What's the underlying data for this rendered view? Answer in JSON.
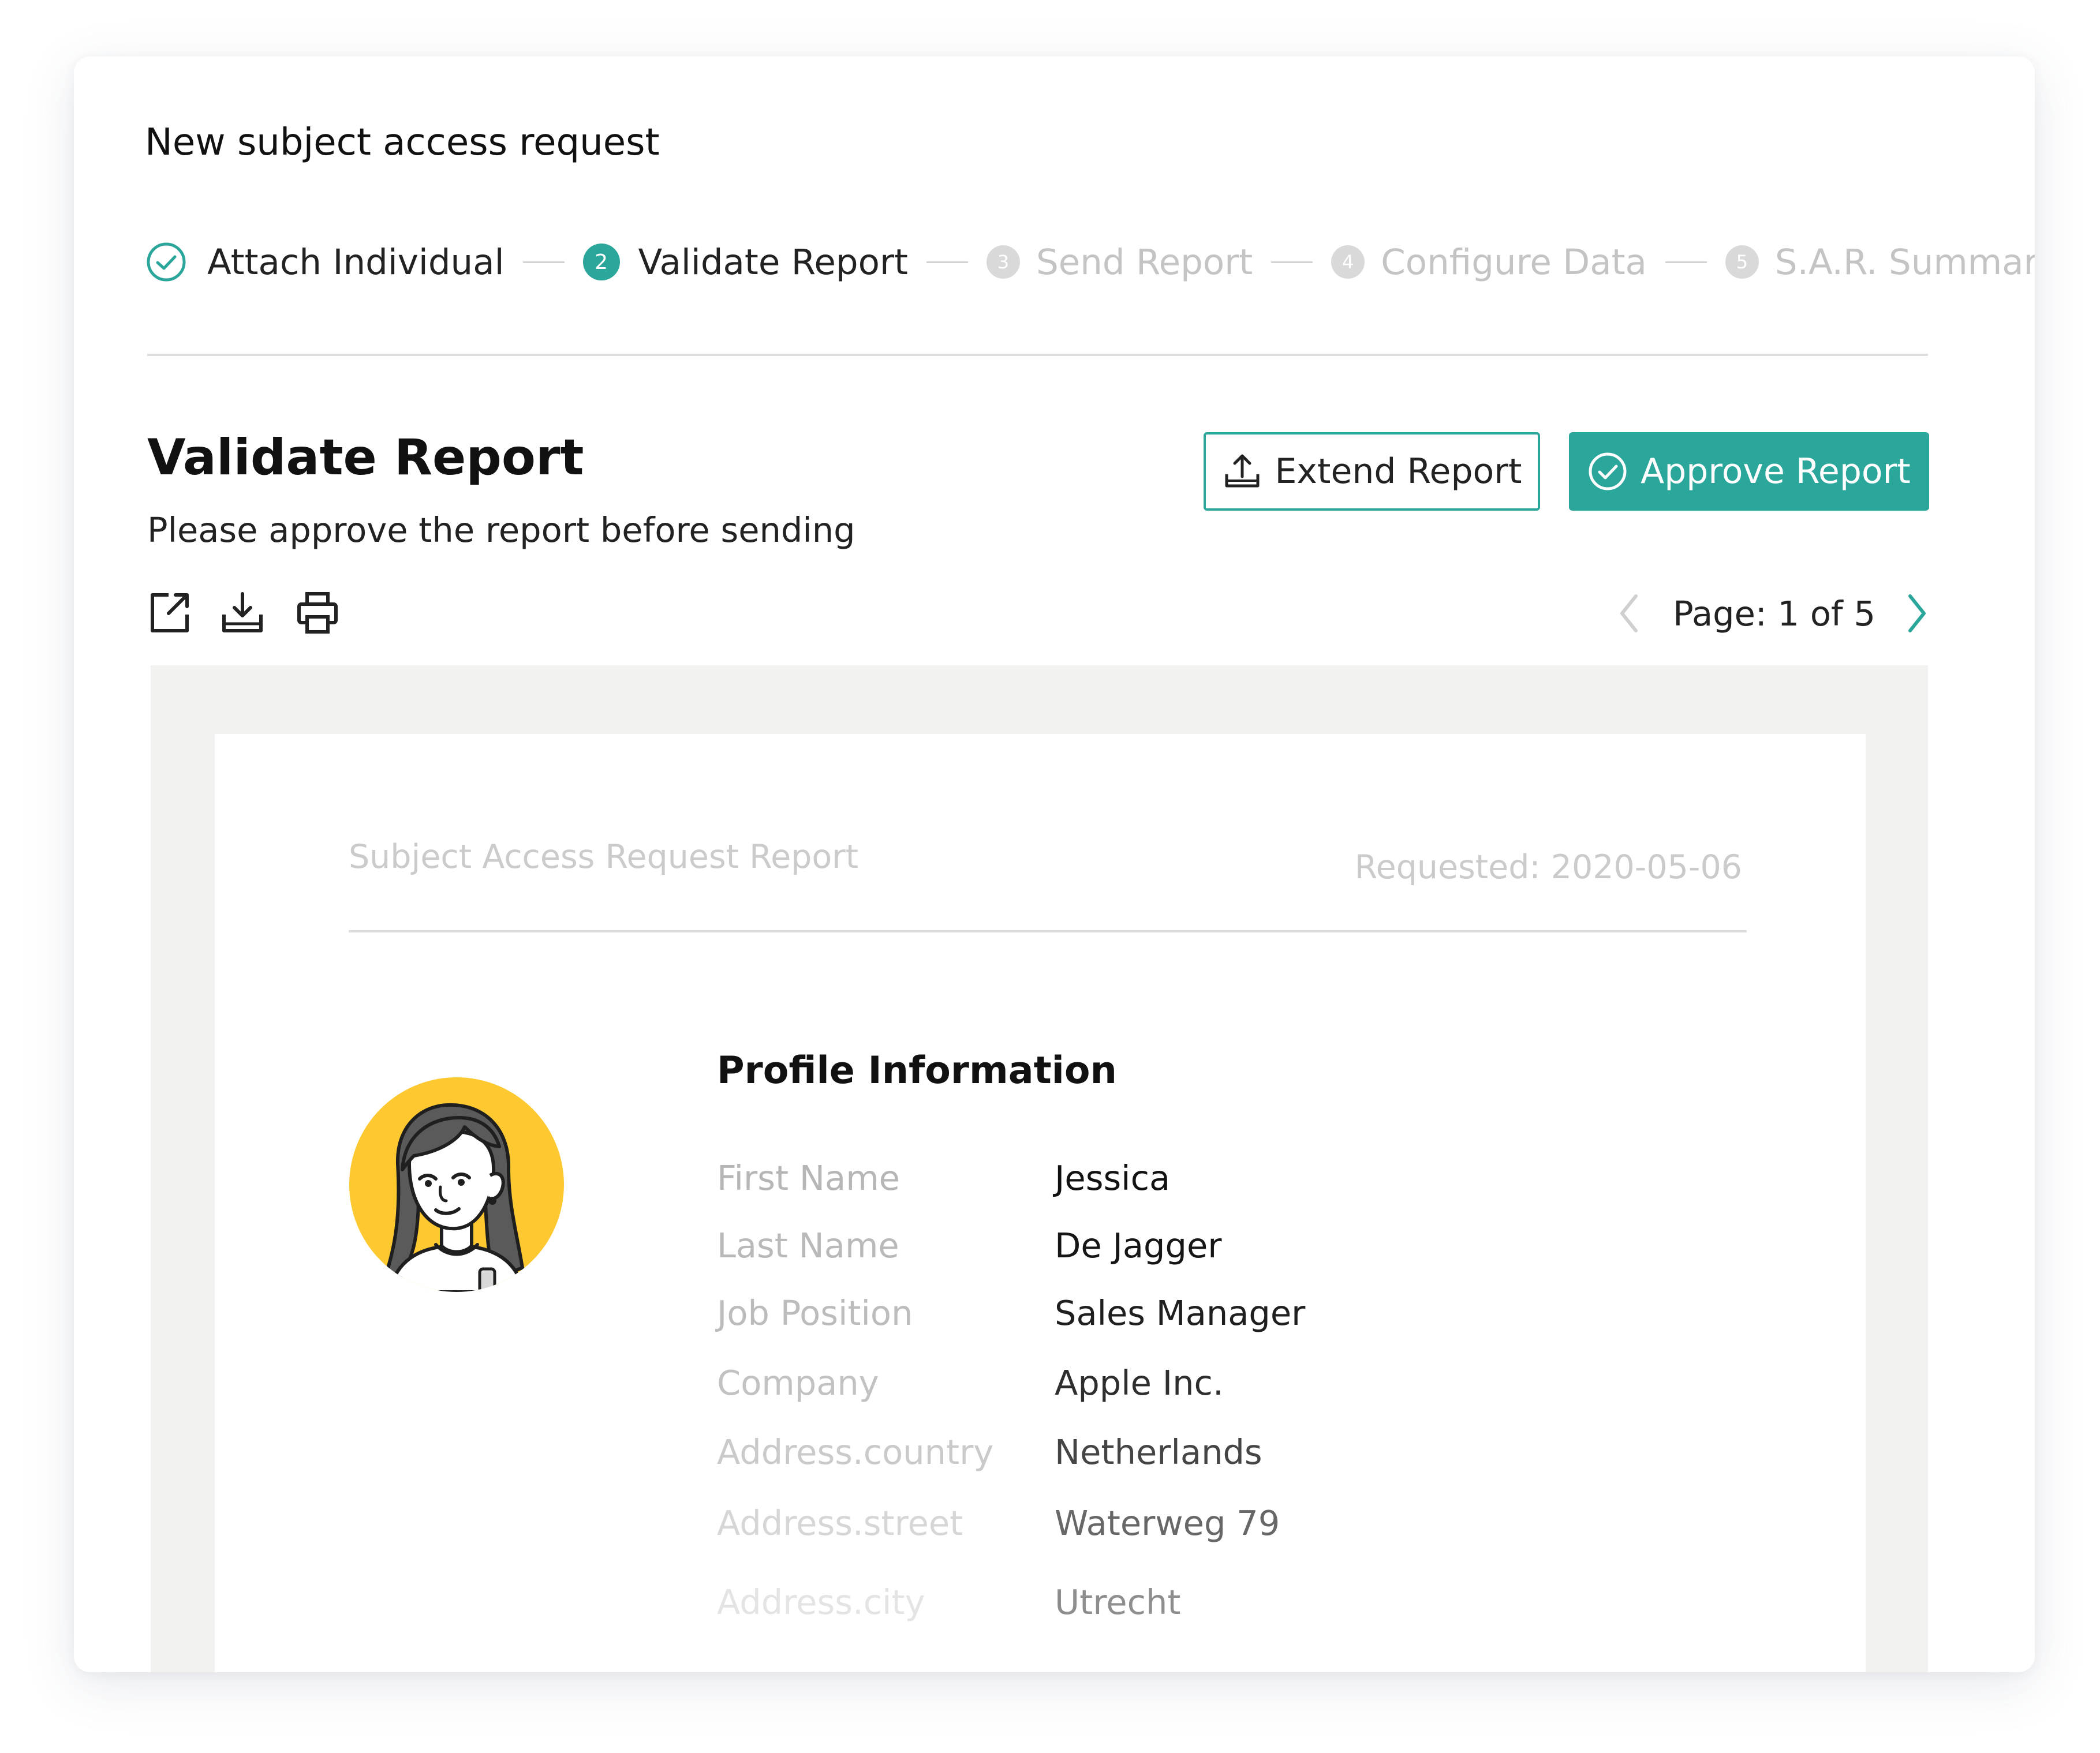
{
  "dialog": {
    "title": "New subject access request"
  },
  "stepper": {
    "steps": [
      {
        "number": "1",
        "label": "Attach Individual",
        "state": "done"
      },
      {
        "number": "2",
        "label": "Validate Report",
        "state": "active"
      },
      {
        "number": "3",
        "label": "Send Report",
        "state": "todo"
      },
      {
        "number": "4",
        "label": "Configure Data",
        "state": "todo"
      },
      {
        "number": "5",
        "label": "S.A.R. Summary",
        "state": "todo"
      }
    ]
  },
  "section": {
    "title": "Validate Report",
    "subtitle": "Please approve the report before sending"
  },
  "actions": {
    "extend_label": "Extend Report",
    "approve_label": "Approve Report"
  },
  "toolbar": {
    "icons": [
      "open-external-icon",
      "download-icon",
      "print-icon"
    ]
  },
  "pager": {
    "text": "Page: 1 of 5"
  },
  "report": {
    "title": "Subject Access Request Report",
    "requested": "Requested: 2020-05-06",
    "profile_title": "Profile Information",
    "fields": [
      {
        "label": "First Name",
        "value": "Jessica"
      },
      {
        "label": "Last Name",
        "value": "De Jagger"
      },
      {
        "label": "Job Position",
        "value": "Sales Manager"
      },
      {
        "label": "Company",
        "value": "Apple Inc."
      },
      {
        "label": "Address.country",
        "value": "Netherlands"
      },
      {
        "label": "Address.street",
        "value": "Waterweg 79"
      },
      {
        "label": "Address.city",
        "value": "Utrecht"
      }
    ]
  },
  "colors": {
    "accent": "#2ba69a",
    "avatar_background": "#fdc830",
    "viewer_background": "#f2f2f0",
    "muted_text": "#c4c4c4"
  }
}
